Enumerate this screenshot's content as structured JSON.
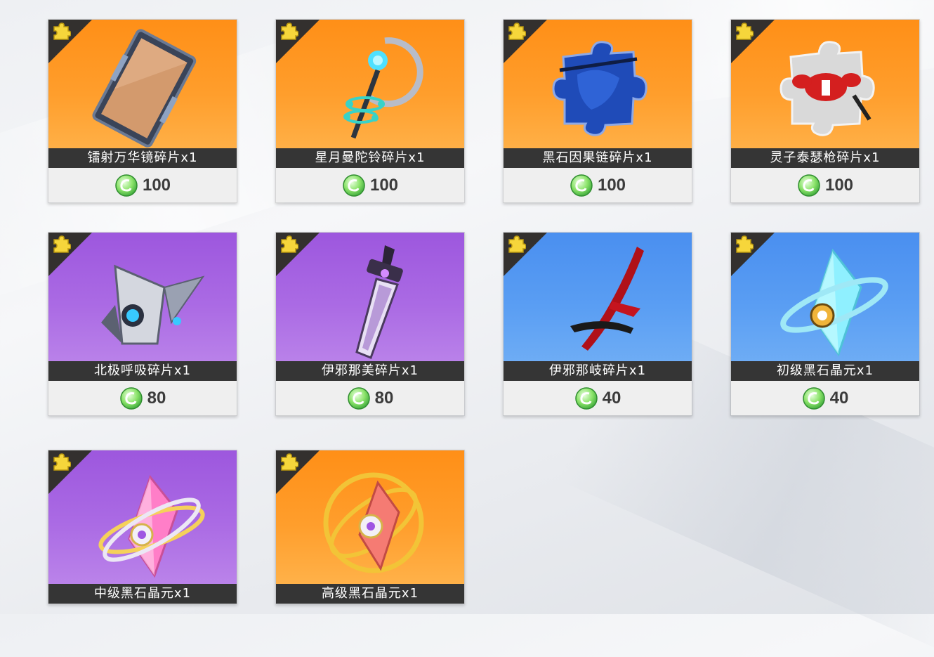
{
  "items": [
    {
      "name": "镭射万华镜碎片x1",
      "price": "100",
      "theme": "orange",
      "icon": "laser-kaleidoscope-fragment-icon"
    },
    {
      "name": "星月曼陀铃碎片x1",
      "price": "100",
      "theme": "orange",
      "icon": "star-moon-mandolin-fragment-icon"
    },
    {
      "name": "黑石因果链碎片x1",
      "price": "100",
      "theme": "orange",
      "icon": "blackstone-causal-chain-fragment-icon"
    },
    {
      "name": "灵子泰瑟枪碎片x1",
      "price": "100",
      "theme": "orange",
      "icon": "reishi-taser-fragment-icon"
    },
    {
      "name": "北极呼吸碎片x1",
      "price": "80",
      "theme": "purple",
      "icon": "arctic-breath-fragment-icon"
    },
    {
      "name": "伊邪那美碎片x1",
      "price": "80",
      "theme": "purple",
      "icon": "izanami-fragment-icon"
    },
    {
      "name": "伊邪那岐碎片x1",
      "price": "40",
      "theme": "blue",
      "icon": "izanagi-fragment-icon"
    },
    {
      "name": "初级黑石晶元x1",
      "price": "40",
      "theme": "blue",
      "icon": "basic-blackstone-crystal-icon"
    },
    {
      "name": "中级黑石晶元x1",
      "price": "",
      "theme": "purple",
      "icon": "intermediate-blackstone-crystal-icon"
    },
    {
      "name": "高级黑石晶元x1",
      "price": "",
      "theme": "orange",
      "icon": "advanced-blackstone-crystal-icon"
    }
  ],
  "currency_icon": "green-crystal-coin-icon",
  "badge_icon": "puzzle-piece-icon",
  "colors": {
    "orange": "#ff9e2c",
    "purple": "#ab6be4",
    "blue": "#5a9ef3",
    "name_bar": "#353535",
    "price_bar": "#efefef"
  }
}
